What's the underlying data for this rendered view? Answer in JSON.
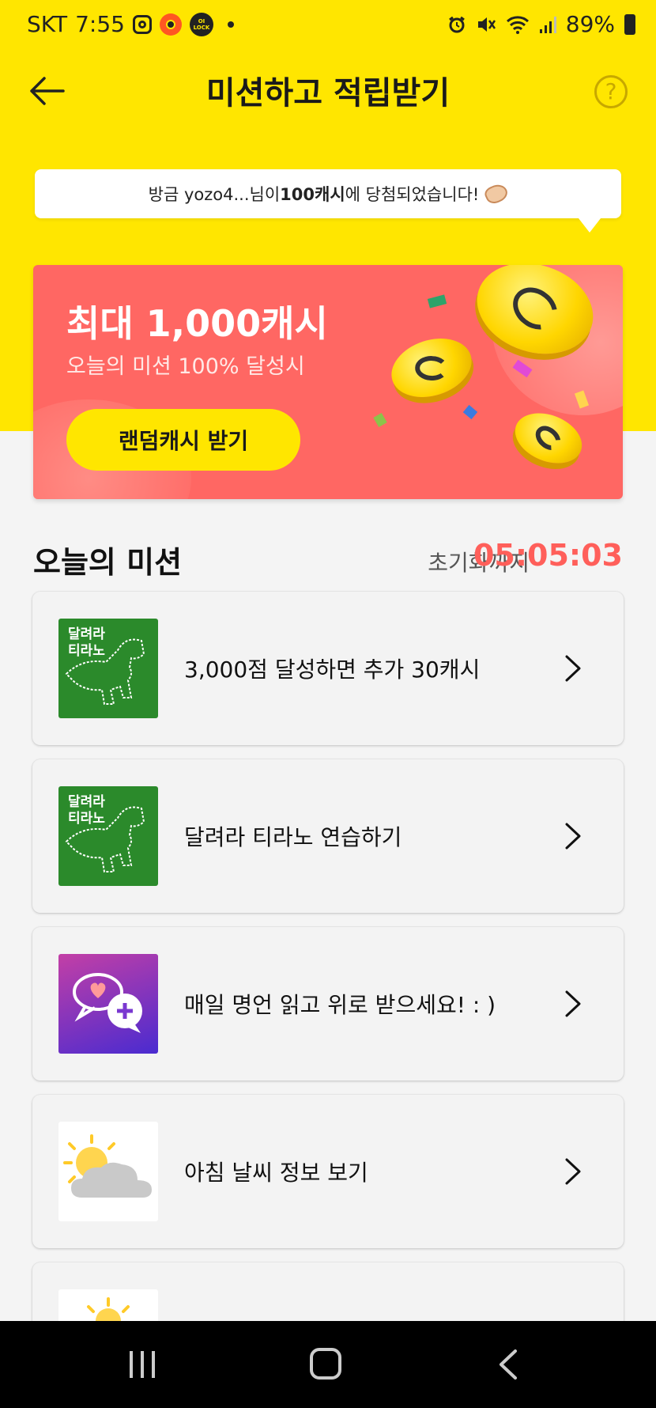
{
  "status_bar": {
    "carrier": "SKT",
    "time": "7:55",
    "lock_badge": "OI LOCK",
    "battery": "89%"
  },
  "header": {
    "title": "미션하고 적립받기",
    "help_label": "?"
  },
  "toast": {
    "prefix": "방금 yozo4...님이 ",
    "highlight": "100캐시",
    "suffix": "에 당첨되었습니다!"
  },
  "banner": {
    "title": "최대 1,000캐시",
    "subtitle": "오늘의 미션 100% 달성시",
    "button_label": "랜덤캐시 받기"
  },
  "missions": {
    "section_title": "오늘의 미션",
    "reset_label": "초기화까지",
    "reset_time": "05:05:03",
    "thumb_text_line1": "달려라",
    "thumb_text_line2": "티라노",
    "items": [
      {
        "label": "3,000점 달성하면 추가 30캐시",
        "icon": "tirano-game-icon"
      },
      {
        "label": "달려라 티라노 연습하기",
        "icon": "tirano-game-icon"
      },
      {
        "label": "매일 명언 읽고 위로 받으세요! : )",
        "icon": "quote-chat-icon"
      },
      {
        "label": "아침 날씨 정보 보기",
        "icon": "weather-icon"
      }
    ]
  },
  "colors": {
    "brand_yellow": "#ffe600",
    "banner_red": "#ff6763",
    "timer_red": "#ff5f5a"
  }
}
